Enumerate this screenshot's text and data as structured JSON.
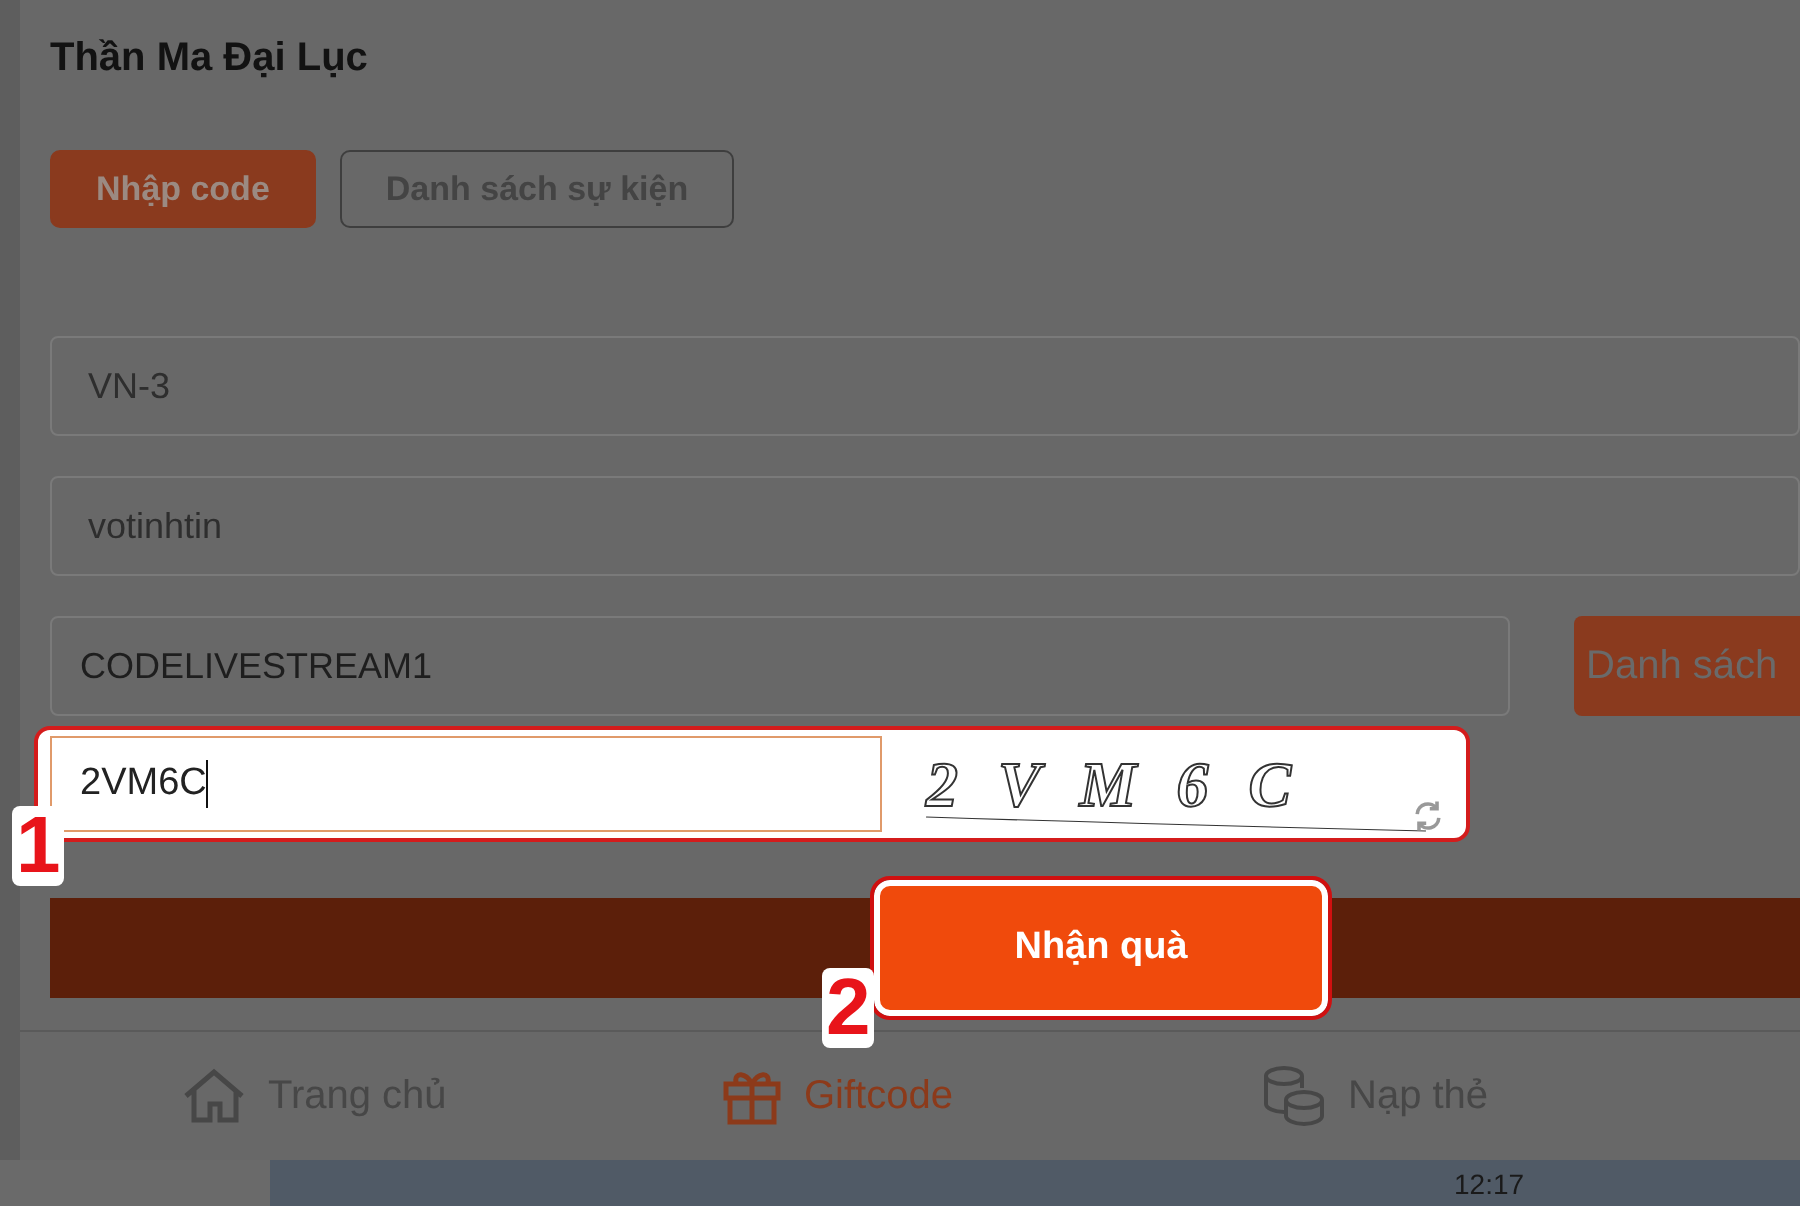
{
  "app_title": "Thần Ma Đại Lục",
  "tabs": [
    {
      "label": "Nhập code",
      "selected": true
    },
    {
      "label": "Danh sách sự kiện",
      "selected": false
    }
  ],
  "fields": [
    {
      "kind": "select",
      "value": "VN-3"
    },
    {
      "kind": "select",
      "value": "votinhtin"
    },
    {
      "kind": "input",
      "value": "CODELIVESTREAM1",
      "button": "Danh sách"
    }
  ],
  "captcha": {
    "value": "2VM6C",
    "image_text": "2 V M 6 C"
  },
  "submit_button": "Nhận quà",
  "annotations": [
    "1",
    "2"
  ],
  "bottom_nav": [
    {
      "label": "Trang chủ",
      "selected": false
    },
    {
      "label": "Giftcode",
      "selected": true
    },
    {
      "label": "Nạp thẻ",
      "selected": false
    }
  ],
  "clock": "12:17"
}
